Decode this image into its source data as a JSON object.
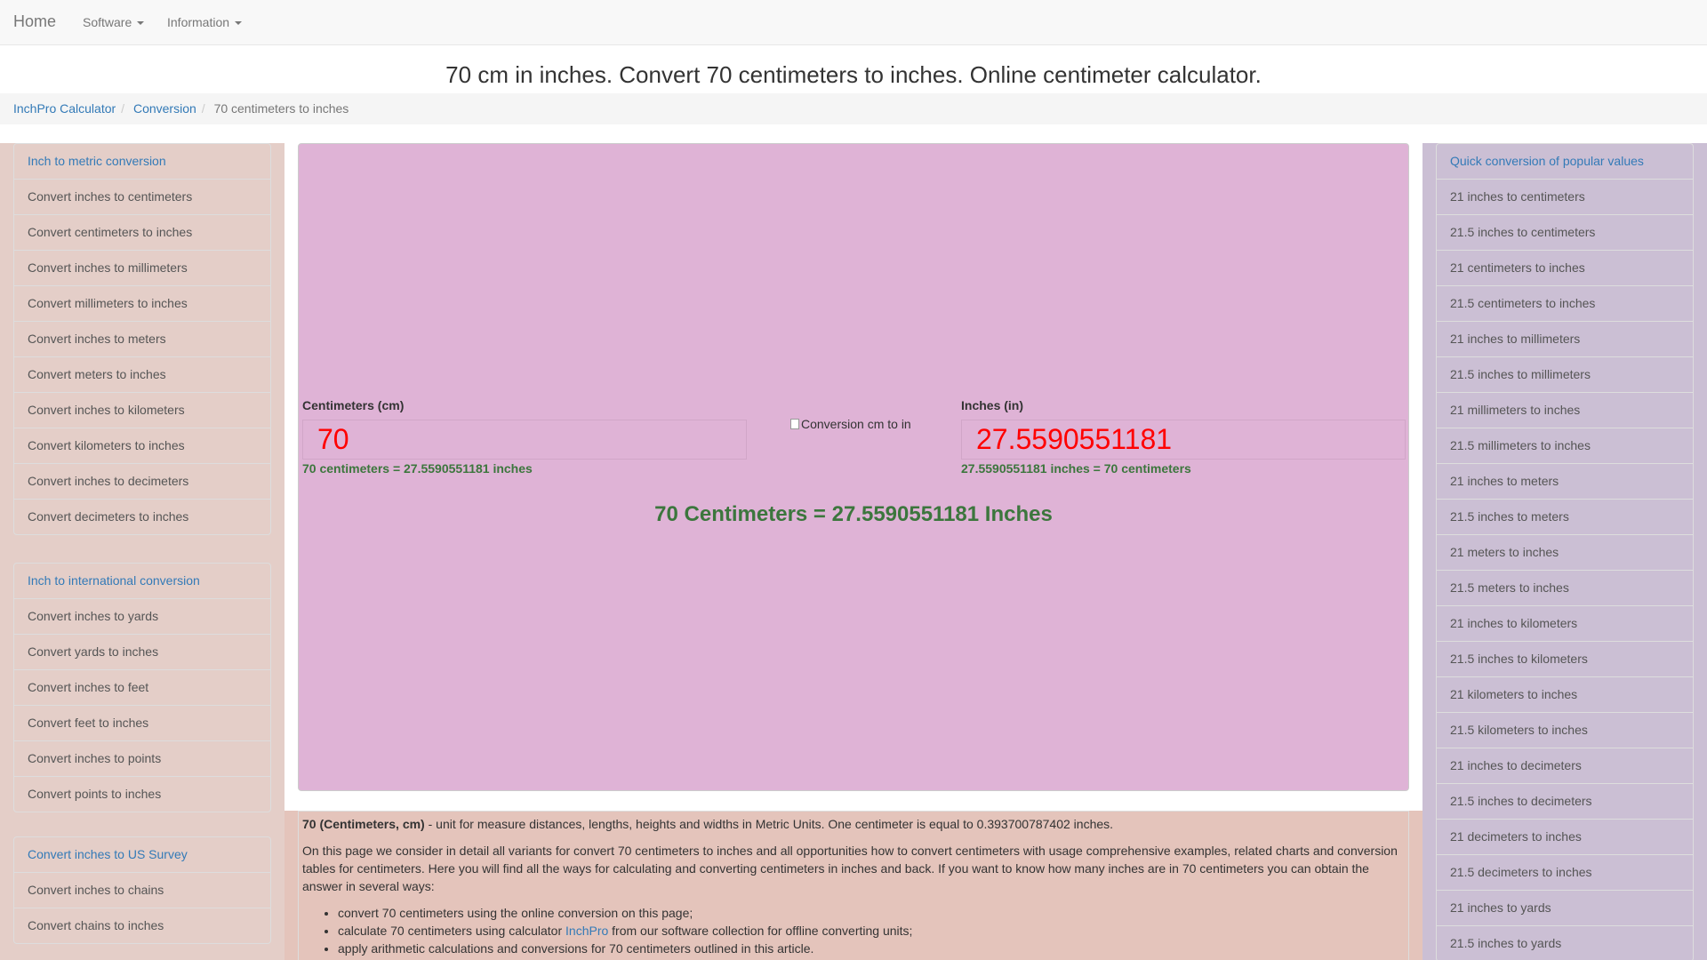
{
  "navbar": {
    "brand": "Home",
    "items": [
      {
        "label": "Software"
      },
      {
        "label": "Information"
      }
    ]
  },
  "page": {
    "title": "70 cm in inches. Convert 70 centimeters to inches. Online centimeter calculator."
  },
  "breadcrumb": {
    "items": [
      "InchPro Calculator",
      "Conversion"
    ],
    "active": "70 centimeters to inches"
  },
  "left_sidebar": {
    "groups": [
      {
        "heading": "Inch to metric conversion",
        "items": [
          "Convert inches to centimeters",
          "Convert centimeters to inches",
          "Convert inches to millimeters",
          "Convert millimeters to inches",
          "Convert inches to meters",
          "Convert meters to inches",
          "Convert inches to kilometers",
          "Convert kilometers to inches",
          "Convert inches to decimeters",
          "Convert decimeters to inches"
        ]
      },
      {
        "heading": "Inch to international conversion",
        "items": [
          "Convert inches to yards",
          "Convert yards to inches",
          "Convert inches to feet",
          "Convert feet to inches",
          "Convert inches to points",
          "Convert points to inches"
        ]
      },
      {
        "heading": "Convert inches to US Survey",
        "items": [
          "Convert inches to chains",
          "Convert chains to inches"
        ]
      }
    ]
  },
  "right_sidebar": {
    "heading": "Quick conversion of popular values",
    "items": [
      "21 inches to centimeters",
      "21.5 inches to centimeters",
      "21 centimeters to inches",
      "21.5 centimeters to inches",
      "21 inches to millimeters",
      "21.5 inches to millimeters",
      "21 millimeters to inches",
      "21.5 millimeters to inches",
      "21 inches to meters",
      "21.5 inches to meters",
      "21 meters to inches",
      "21.5 meters to inches",
      "21 inches to kilometers",
      "21.5 inches to kilometers",
      "21 kilometers to inches",
      "21.5 kilometers to inches",
      "21 inches to decimeters",
      "21.5 inches to decimeters",
      "21 decimeters to inches",
      "21.5 decimeters to inches",
      "21 inches to yards",
      "21.5 inches to yards"
    ]
  },
  "calculator": {
    "from_label": "Centimeters (cm)",
    "from_value": "70",
    "from_result": "70 centimeters = 27.5590551181 inches",
    "image_alt": "Conversion cm to in",
    "to_label": "Inches (in)",
    "to_value": "27.5590551181",
    "to_result": "27.5590551181 inches = 70 centimeters",
    "summary": "70 Centimeters = 27.5590551181 Inches"
  },
  "info": {
    "definition_bold": "70 (Centimeters, cm)",
    "definition_rest": " - unit for measure distances, lengths, heights and widths in Metric Units. One centimeter is equal to 0.393700787402 inches.",
    "paragraph": "On this page we consider in detail all variants for convert 70 centimeters to inches and all opportunities how to convert centimeters with usage comprehensive examples, related charts and conversion tables for centimeters. Here you will find all the ways for calculating and converting centimeters in inches and back. If you want to know how many inches are in 70 centimeters you can obtain the answer in several ways:",
    "bullet1": "convert 70 centimeters using the online conversion on this page;",
    "bullet2_pre": "calculate 70 centimeters using calculator ",
    "bullet2_link": "InchPro",
    "bullet2_post": " from our software collection for offline converting units;",
    "bullet3": "apply arithmetic calculations and conversions for 70 centimeters outlined in this article."
  },
  "colors": {
    "calc_bg": "#dfb3d6",
    "left_bg": "#e4cec8",
    "right_bg": "#cbbfd4",
    "result_green": "#3c763d",
    "value_red": "#ff0000",
    "link": "#337ab7"
  }
}
